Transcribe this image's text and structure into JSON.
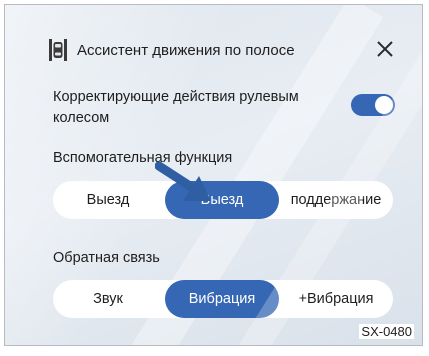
{
  "header": {
    "title": "Ассистент движения по полосе",
    "icon": "lane-assist-car-icon",
    "close_icon": "close-icon"
  },
  "steering_correction": {
    "label": "Корректирующие действия рулевым колесом",
    "enabled": true,
    "accent_color": "#3567b4"
  },
  "assist_function": {
    "label": "Вспомогательная функция",
    "options": [
      {
        "label": "Выезд",
        "selected": false
      },
      {
        "label": "Выезд",
        "selected": true
      },
      {
        "label": "поддержание",
        "selected": false
      }
    ]
  },
  "feedback": {
    "label": "Обратная связь",
    "options": [
      {
        "label": "Звук",
        "selected": false
      },
      {
        "label": "Вибрация",
        "selected": true
      },
      {
        "label": "+Вибрация",
        "selected": false
      }
    ]
  },
  "figure_code": "SX-0480",
  "colors": {
    "accent": "#3567b4",
    "arrow": "#2f5ea3"
  }
}
